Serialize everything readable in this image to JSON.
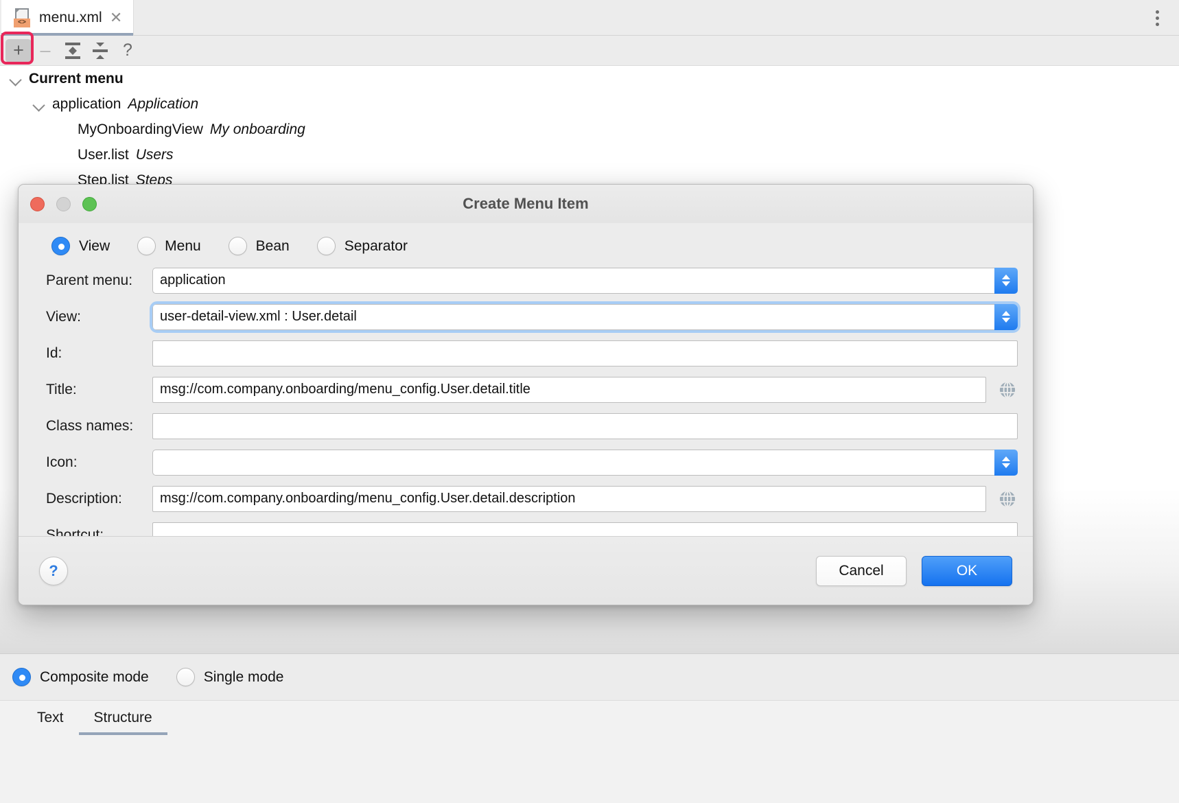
{
  "editor": {
    "tab": {
      "label": "menu.xml",
      "icon": "xml-file-icon",
      "badge": "<>",
      "close_icon": "close-icon"
    },
    "overflow_icon": "kebab-menu-icon"
  },
  "toolbar": {
    "add_label": "+",
    "add_icon": "plus-icon",
    "remove_label": "–",
    "remove_icon": "minus-icon",
    "expand_icon": "expand-all-icon",
    "collapse_icon": "collapse-all-icon",
    "help_label": "?",
    "help_icon": "question-mark-icon"
  },
  "tree": {
    "nodes": [
      {
        "name": "Current menu",
        "desc": "",
        "level": 0,
        "expanded": true
      },
      {
        "name": "application",
        "desc": "Application",
        "level": 1,
        "expanded": true
      },
      {
        "name": "MyOnboardingView",
        "desc": "My onboarding",
        "level": 2,
        "expanded": false
      },
      {
        "name": "User.list",
        "desc": "Users",
        "level": 2,
        "expanded": false
      },
      {
        "name": "Step.list",
        "desc": "Steps",
        "level": 2,
        "expanded": false
      }
    ]
  },
  "dialog": {
    "title": "Create Menu Item",
    "window_controls": {
      "close": "close-traffic-light",
      "minimize": "minimize-traffic-light",
      "zoom": "zoom-traffic-light"
    },
    "type_options": [
      {
        "label": "View",
        "selected": true
      },
      {
        "label": "Menu",
        "selected": false
      },
      {
        "label": "Bean",
        "selected": false
      },
      {
        "label": "Separator",
        "selected": false
      }
    ],
    "fields": [
      {
        "label": "Parent menu:",
        "value": "application",
        "placeholder": "",
        "kind": "combo",
        "focused": false,
        "globe": false
      },
      {
        "label": "View:",
        "value": "user-detail-view.xml : User.detail",
        "placeholder": "",
        "kind": "combo",
        "focused": true,
        "globe": false
      },
      {
        "label": "Id:",
        "value": "",
        "placeholder": "",
        "kind": "text",
        "focused": false,
        "globe": false
      },
      {
        "label": "Title:",
        "value": "msg://com.company.onboarding/menu_config.User.detail.title",
        "placeholder": "",
        "kind": "text",
        "focused": false,
        "globe": true
      },
      {
        "label": "Class names:",
        "value": "",
        "placeholder": "",
        "kind": "text",
        "focused": false,
        "globe": false
      },
      {
        "label": "Icon:",
        "value": "",
        "placeholder": "",
        "kind": "combo",
        "focused": false,
        "globe": false
      },
      {
        "label": "Description:",
        "value": "msg://com.company.onboarding/menu_config.User.detail.description",
        "placeholder": "",
        "kind": "text",
        "focused": false,
        "globe": true
      },
      {
        "label": "Shortcut:",
        "value": "",
        "placeholder": "",
        "kind": "text",
        "focused": false,
        "globe": false
      }
    ],
    "help_label": "?",
    "cancel_label": "Cancel",
    "ok_label": "OK"
  },
  "modebar": {
    "options": [
      {
        "label": "Composite mode",
        "selected": true
      },
      {
        "label": "Single mode",
        "selected": false
      }
    ]
  },
  "bottom_tabs": [
    {
      "label": "Text",
      "active": false
    },
    {
      "label": "Structure",
      "active": true
    }
  ],
  "colors": {
    "accent_blue": "#1f7bef",
    "highlight_pink": "#e8275a",
    "tab_underline": "#95a4b8",
    "globe": "#9fadb8"
  }
}
